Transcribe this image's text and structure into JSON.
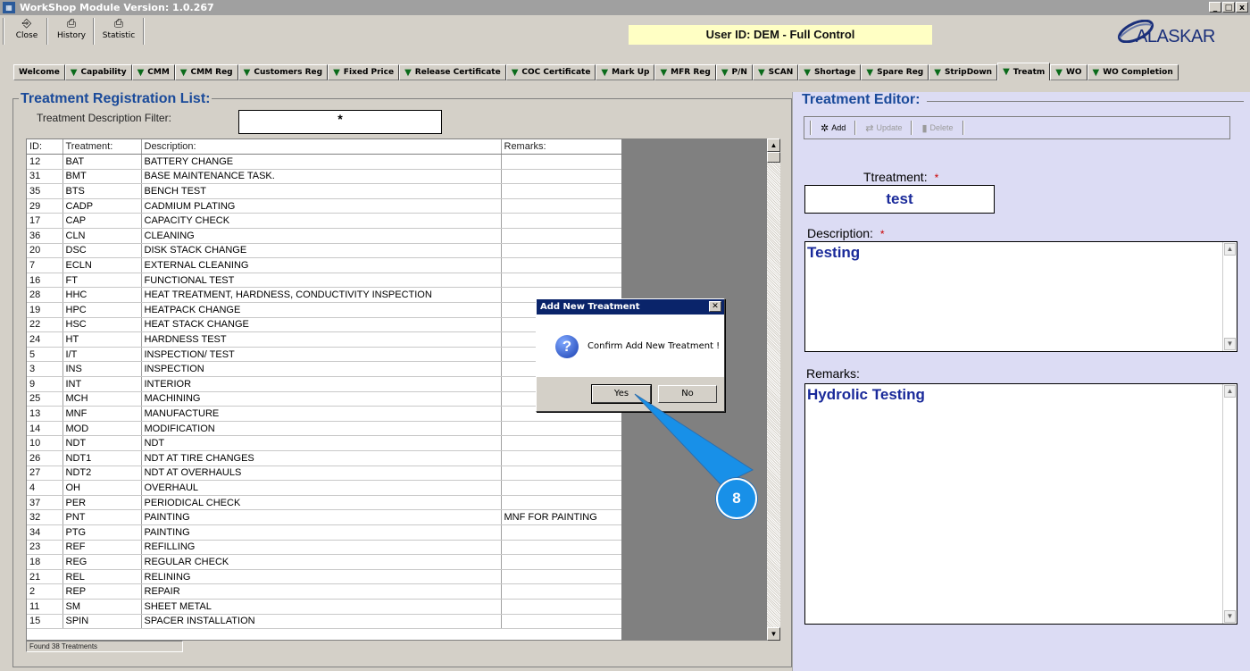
{
  "window": {
    "title": "WorkShop Module  Version: 1.0.267",
    "controls": [
      "_",
      "□",
      "x"
    ]
  },
  "toolbar": {
    "buttons": [
      {
        "label": "Close",
        "icon": "door-exit-icon"
      },
      {
        "label": "History",
        "icon": "printer-icon"
      },
      {
        "label": "Statistic",
        "icon": "printer-icon"
      }
    ],
    "user_id": "User ID: DEM - Full Control",
    "logo_text": "ALASKAR"
  },
  "tabs": [
    {
      "label": "Welcome",
      "icon": false
    },
    {
      "label": "Capability",
      "icon": true
    },
    {
      "label": "CMM",
      "icon": true
    },
    {
      "label": "CMM Reg",
      "icon": true
    },
    {
      "label": "Customers Reg",
      "icon": true
    },
    {
      "label": "Fixed Price",
      "icon": true
    },
    {
      "label": "Release Certificate",
      "icon": true
    },
    {
      "label": "COC Certificate",
      "icon": true
    },
    {
      "label": "Mark Up",
      "icon": true
    },
    {
      "label": "MFR Reg",
      "icon": true
    },
    {
      "label": "P/N",
      "icon": true
    },
    {
      "label": "SCAN",
      "icon": true
    },
    {
      "label": "Shortage",
      "icon": true
    },
    {
      "label": "Spare Reg",
      "icon": true
    },
    {
      "label": "StripDown",
      "icon": true
    },
    {
      "label": "Treatm",
      "icon": true,
      "active": true
    },
    {
      "label": "WO",
      "icon": true
    },
    {
      "label": "WO Completion",
      "icon": true
    }
  ],
  "list_panel": {
    "title": "Treatment Registration List:",
    "filter_label": "Treatment Description Filter:",
    "filter_value": "*",
    "columns": [
      "ID:",
      "Treatment:",
      "Description:",
      "Remarks:"
    ],
    "rows": [
      [
        "12",
        "BAT",
        "BATTERY CHANGE",
        ""
      ],
      [
        "31",
        "BMT",
        "BASE MAINTENANCE TASK.",
        ""
      ],
      [
        "35",
        "BTS",
        "BENCH TEST",
        ""
      ],
      [
        "29",
        "CADP",
        "CADMIUM PLATING",
        ""
      ],
      [
        "17",
        "CAP",
        "CAPACITY CHECK",
        ""
      ],
      [
        "36",
        "CLN",
        "CLEANING",
        ""
      ],
      [
        "20",
        "DSC",
        "DISK STACK CHANGE",
        ""
      ],
      [
        "7",
        "ECLN",
        "EXTERNAL CLEANING",
        ""
      ],
      [
        "16",
        "FT",
        "FUNCTIONAL TEST",
        ""
      ],
      [
        "28",
        "HHC",
        "HEAT TREATMENT, HARDNESS, CONDUCTIVITY INSPECTION",
        ""
      ],
      [
        "19",
        "HPC",
        "HEATPACK CHANGE",
        ""
      ],
      [
        "22",
        "HSC",
        "HEAT STACK CHANGE",
        ""
      ],
      [
        "24",
        "HT",
        "HARDNESS TEST",
        ""
      ],
      [
        "5",
        "I/T",
        "INSPECTION/ TEST",
        ""
      ],
      [
        "3",
        "INS",
        "INSPECTION",
        ""
      ],
      [
        "9",
        "INT",
        "INTERIOR",
        ""
      ],
      [
        "25",
        "MCH",
        "MACHINING",
        ""
      ],
      [
        "13",
        "MNF",
        "MANUFACTURE",
        ""
      ],
      [
        "14",
        "MOD",
        "MODIFICATION",
        ""
      ],
      [
        "10",
        "NDT",
        "NDT",
        ""
      ],
      [
        "26",
        "NDT1",
        "NDT AT TIRE CHANGES",
        ""
      ],
      [
        "27",
        "NDT2",
        "NDT AT OVERHAULS",
        ""
      ],
      [
        "4",
        "OH",
        "OVERHAUL",
        ""
      ],
      [
        "37",
        "PER",
        "PERIODICAL CHECK",
        ""
      ],
      [
        "32",
        "PNT",
        "PAINTING",
        "MNF FOR PAINTING"
      ],
      [
        "34",
        "PTG",
        "PAINTING",
        ""
      ],
      [
        "23",
        "REF",
        "REFILLING",
        ""
      ],
      [
        "18",
        "REG",
        "REGULAR CHECK",
        ""
      ],
      [
        "21",
        "REL",
        "RELINING",
        ""
      ],
      [
        "2",
        "REP",
        "REPAIR",
        ""
      ],
      [
        "11",
        "SM",
        "SHEET METAL",
        ""
      ],
      [
        "15",
        "SPIN",
        "SPACER INSTALLATION",
        ""
      ]
    ],
    "status": "Found 38 Treatments"
  },
  "editor": {
    "title": "Treatment Editor:",
    "buttons": {
      "add": "Add",
      "update": "Update",
      "delete": "Delete"
    },
    "treatment_label": "Ttreatment:",
    "treatment_value": "test",
    "description_label": "Description:",
    "description_value": "Testing",
    "remarks_label": "Remarks:",
    "remarks_value": "Hydrolic Testing",
    "required_mark": "*"
  },
  "dialog": {
    "title": "Add New Treatment",
    "message": "Confirm Add New Treatment !",
    "yes": "Yes",
    "no": "No",
    "icon": "question-icon"
  },
  "callout": {
    "step": "8",
    "color": "#1890e8"
  }
}
